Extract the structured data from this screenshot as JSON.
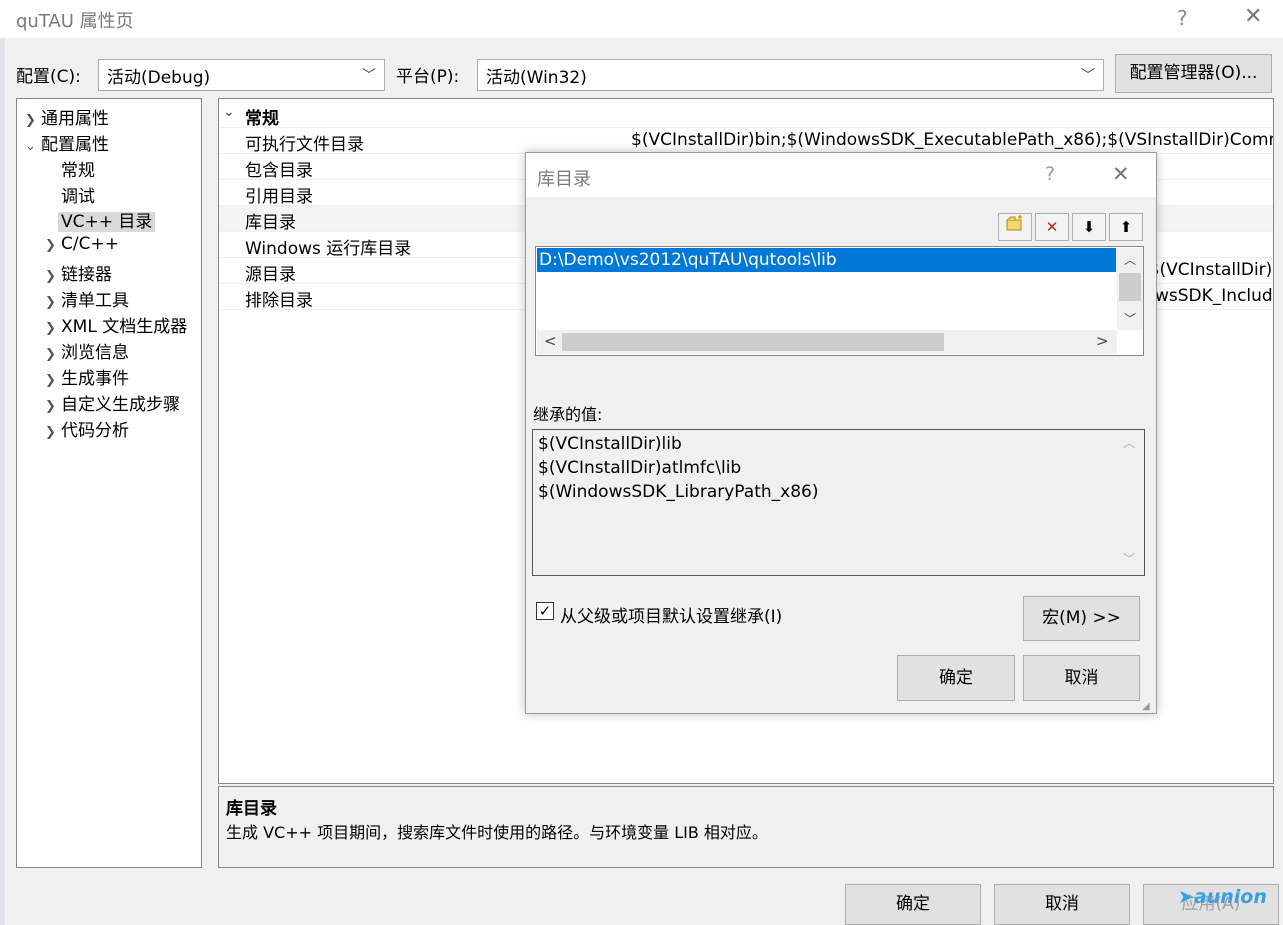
{
  "window": {
    "title": "quTAU 属性页",
    "help_glyph": "?",
    "close_glyph": "✕"
  },
  "config_row": {
    "config_label": "配置(C):",
    "config_value": "活动(Debug)",
    "platform_label": "平台(P):",
    "platform_value": "活动(Win32)",
    "manager_button": "配置管理器(O)..."
  },
  "tree": {
    "items": [
      {
        "label": "通用属性",
        "chevron": ">"
      },
      {
        "label": "配置属性",
        "chevron": "v"
      },
      {
        "label": "常规",
        "chevron": ""
      },
      {
        "label": "调试",
        "chevron": ""
      },
      {
        "label": "VC++ 目录",
        "chevron": ""
      },
      {
        "label": "C/C++",
        "chevron": ">"
      },
      {
        "label": "链接器",
        "chevron": ">"
      },
      {
        "label": "清单工具",
        "chevron": ">"
      },
      {
        "label": "XML 文档生成器",
        "chevron": ">"
      },
      {
        "label": "浏览信息",
        "chevron": ">"
      },
      {
        "label": "生成事件",
        "chevron": ">"
      },
      {
        "label": "自定义生成步骤",
        "chevron": ">"
      },
      {
        "label": "代码分析",
        "chevron": ">"
      }
    ]
  },
  "grid": {
    "section": "常规",
    "rows": [
      {
        "name": "可执行文件目录",
        "value": "$(VCInstallDir)bin;$(WindowsSDK_ExecutablePath_x86);$(VSInstallDir)Comm"
      },
      {
        "name": "包含目录",
        "value": ""
      },
      {
        "name": "引用目录",
        "value": ""
      },
      {
        "name": "库目录",
        "value": ""
      },
      {
        "name": "Windows 运行库目录",
        "value": ""
      },
      {
        "name": "源目录",
        "value": ";$(VCInstallDir)"
      },
      {
        "name": "排除目录",
        "value": "wsSDK_Include"
      }
    ]
  },
  "description": {
    "title": "库目录",
    "text": "生成 VC++ 项目期间，搜索库文件时使用的路径。与环境变量 LIB 相对应。"
  },
  "footer": {
    "ok": "确定",
    "cancel": "取消",
    "apply": "应用(A)",
    "watermark": "aunion"
  },
  "dialog": {
    "title": "库目录",
    "help_glyph": "?",
    "close_glyph": "✕",
    "toolbar": {
      "new": "new-line",
      "delete": "✕",
      "down": "🡇",
      "up": "🡅"
    },
    "entries": [
      "D:\\Demo\\vs2012\\quTAU\\qutools\\lib"
    ],
    "inherited_label": "继承的值:",
    "inherited_values": [
      "$(VCInstallDir)lib",
      "$(VCInstallDir)atlmfc\\lib",
      "$(WindowsSDK_LibraryPath_x86)"
    ],
    "inherit_checkbox_label": "从父级或项目默认设置继承(I)",
    "inherit_checked": true,
    "macro_button": "宏(M) >>",
    "ok": "确定",
    "cancel": "取消"
  },
  "colors": {
    "selection": "#0078d7",
    "tree_selection": "#d9d9d9"
  }
}
